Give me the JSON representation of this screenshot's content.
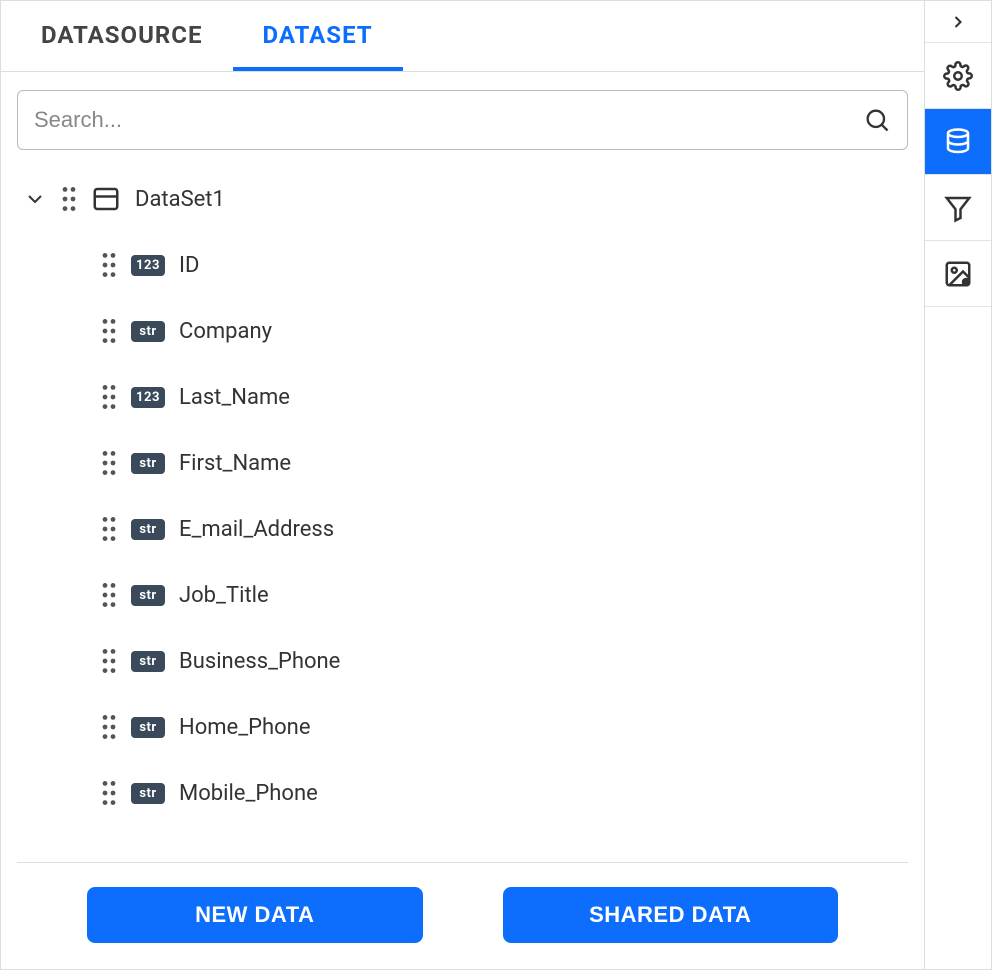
{
  "tabs": {
    "datasource": "DATASOURCE",
    "dataset": "DATASET"
  },
  "search": {
    "placeholder": "Search..."
  },
  "tree": {
    "dataset_name": "DataSet1",
    "fields": [
      {
        "type": "123",
        "name": "ID"
      },
      {
        "type": "str",
        "name": "Company"
      },
      {
        "type": "123",
        "name": "Last_Name"
      },
      {
        "type": "str",
        "name": "First_Name"
      },
      {
        "type": "str",
        "name": "E_mail_Address"
      },
      {
        "type": "str",
        "name": "Job_Title"
      },
      {
        "type": "str",
        "name": "Business_Phone"
      },
      {
        "type": "str",
        "name": "Home_Phone"
      },
      {
        "type": "str",
        "name": "Mobile_Phone"
      }
    ]
  },
  "buttons": {
    "new_data": "NEW DATA",
    "shared_data": "SHARED DATA"
  },
  "sidebar": {
    "collapse_icon": "chevron-right",
    "items": [
      {
        "icon": "gear",
        "active": false
      },
      {
        "icon": "database",
        "active": true
      },
      {
        "icon": "filter",
        "active": false
      },
      {
        "icon": "image-settings",
        "active": false
      }
    ]
  }
}
